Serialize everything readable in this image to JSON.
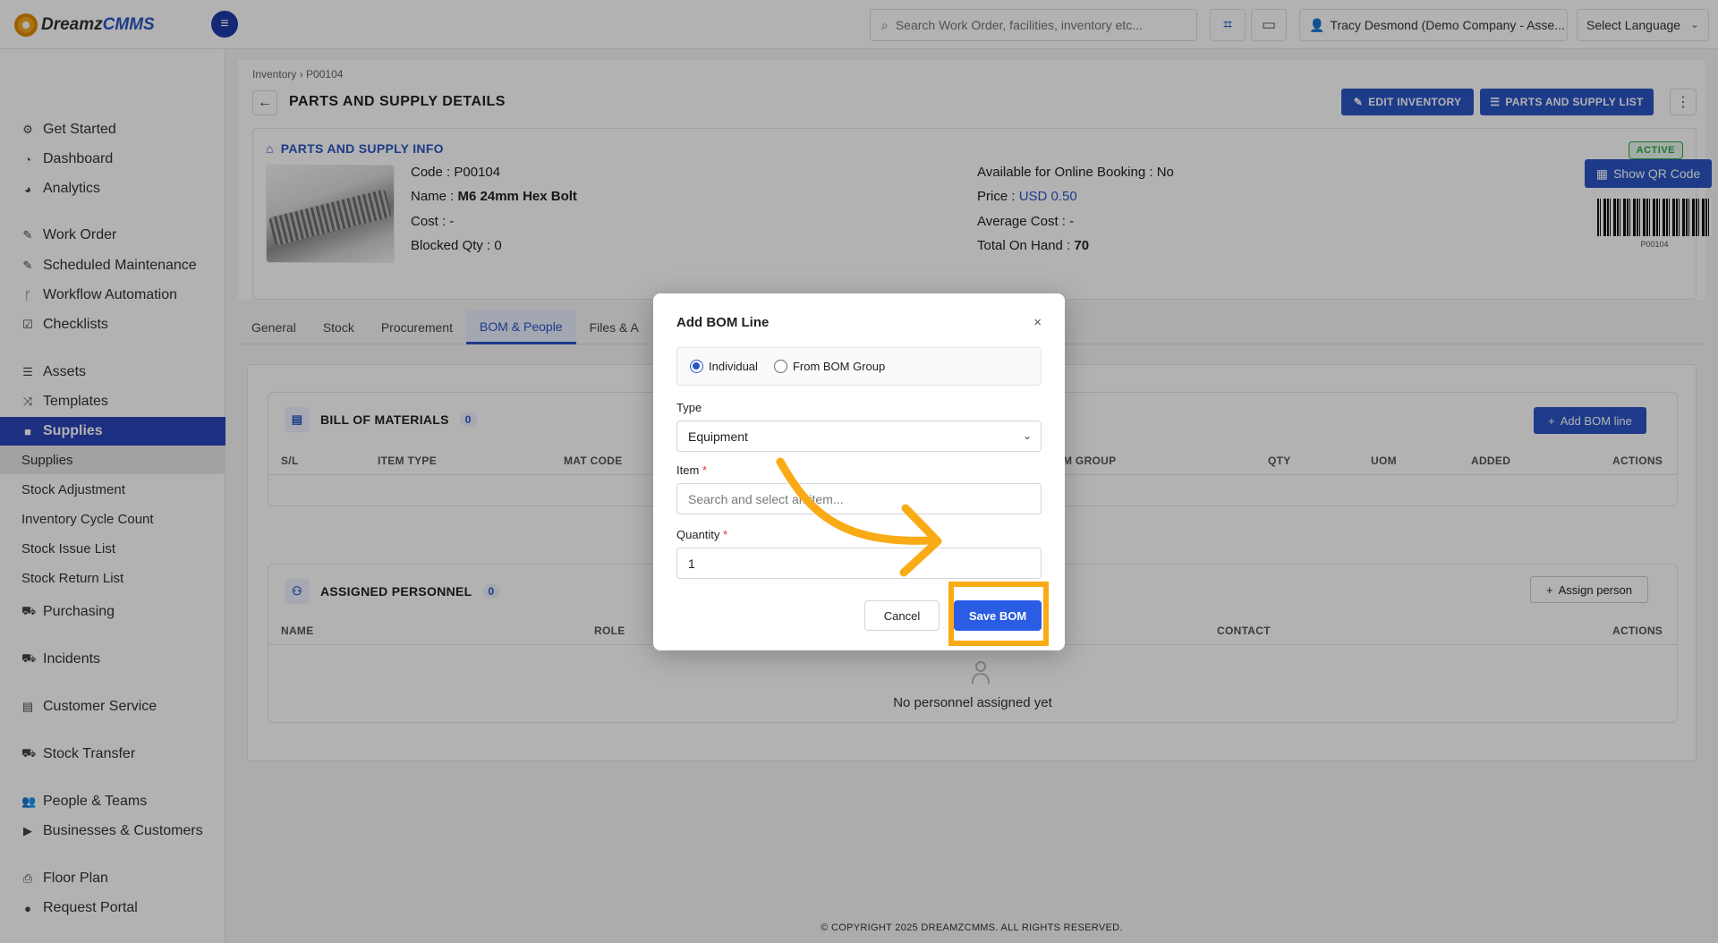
{
  "app": {
    "logo_prefix": "Dreamz",
    "logo_suffix": "CMMS"
  },
  "topbar": {
    "search_placeholder": "Search Work Order, facilities, inventory etc...",
    "user_label": "Tracy Desmond (Demo Company - Asse...",
    "language_label": "Select Language"
  },
  "sidebar": {
    "items": [
      {
        "label": "Get Started",
        "icon": "gears-icon"
      },
      {
        "label": "Dashboard",
        "icon": "dashboard-icon"
      },
      {
        "label": "Analytics",
        "icon": "analytics-icon"
      },
      {
        "label": "Work Order",
        "icon": "wrench-icon"
      },
      {
        "label": "Scheduled Maintenance",
        "icon": "wrench-icon"
      },
      {
        "label": "Workflow Automation",
        "icon": "branch-icon"
      },
      {
        "label": "Checklists",
        "icon": "checkbox-icon"
      },
      {
        "label": "Assets",
        "icon": "list-icon"
      },
      {
        "label": "Templates",
        "icon": "shuffle-icon"
      },
      {
        "label": "Supplies",
        "icon": "supplies-icon"
      },
      {
        "label": "Purchasing",
        "icon": "cart-icon"
      },
      {
        "label": "Incidents",
        "icon": "cart-icon"
      },
      {
        "label": "Customer Service",
        "icon": "file-icon"
      },
      {
        "label": "Stock Transfer",
        "icon": "truck-icon"
      },
      {
        "label": "People & Teams",
        "icon": "users-icon"
      },
      {
        "label": "Businesses & Customers",
        "icon": "video-icon"
      },
      {
        "label": "Floor Plan",
        "icon": "print-icon"
      },
      {
        "label": "Request Portal",
        "icon": "chat-icon"
      }
    ],
    "sub_items": [
      "Supplies",
      "Stock Adjustment",
      "Inventory Cycle Count",
      "Stock Issue List",
      "Stock Return List"
    ]
  },
  "page": {
    "breadcrumb_root": "Inventory",
    "breadcrumb_sep": "›",
    "breadcrumb_current": "P00104",
    "title": "PARTS AND SUPPLY DETAILS",
    "edit_button": "EDIT INVENTORY",
    "list_button": "PARTS AND SUPPLY LIST"
  },
  "info": {
    "title": "PARTS AND SUPPLY INFO",
    "status": "ACTIVE",
    "code_label": "Code :",
    "code": "P00104",
    "name_label": "Name :",
    "name": "M6 24mm Hex Bolt",
    "cost_label": "Cost :",
    "cost": "-",
    "blocked_label": "Blocked Qty :",
    "blocked_qty": "0",
    "online_label": "Available for Online Booking :",
    "online_booking": "No",
    "price_label": "Price :",
    "price": "USD 0.50",
    "avg_cost_label": "Average Cost :",
    "avg_cost": "-",
    "on_hand_label": "Total On Hand :",
    "on_hand": "70",
    "qr_button": "Show QR Code",
    "barcode_text": "P00104"
  },
  "tabs": [
    "General",
    "Stock",
    "Procurement",
    "BOM & People",
    "Files & A"
  ],
  "bom": {
    "title": "BILL OF MATERIALS",
    "count": "0",
    "add_button": "Add BOM line",
    "columns": [
      "S/L",
      "ITEM TYPE",
      "MAT CODE",
      "M GROUP",
      "QTY",
      "UOM",
      "ADDED",
      "ACTIONS"
    ]
  },
  "personnel": {
    "title": "ASSIGNED PERSONNEL",
    "count": "0",
    "assign_button": "Assign person",
    "columns": [
      "NAME",
      "ROLE",
      "CONTACT",
      "ACTIONS"
    ],
    "empty_text": "No personnel assigned yet"
  },
  "footer": "© COPYRIGHT 2025 DREAMZCMMS. ALL RIGHTS RESERVED.",
  "modal": {
    "title": "Add BOM Line",
    "close": "×",
    "radio_individual": "Individual",
    "radio_group": "From BOM Group",
    "selected_mode": "Individual",
    "type_label": "Type",
    "type_value": "Equipment",
    "item_label": "Item",
    "item_placeholder": "Search and select an item...",
    "quantity_label": "Quantity",
    "quantity_value": "1",
    "required_mark": "*",
    "cancel_button": "Cancel",
    "save_button": "Save BOM"
  },
  "colors": {
    "primary": "#2a55c4",
    "sidebar_active": "#2a44b8",
    "highlight": "#f9ab15",
    "status_active": "#2aa84a"
  }
}
